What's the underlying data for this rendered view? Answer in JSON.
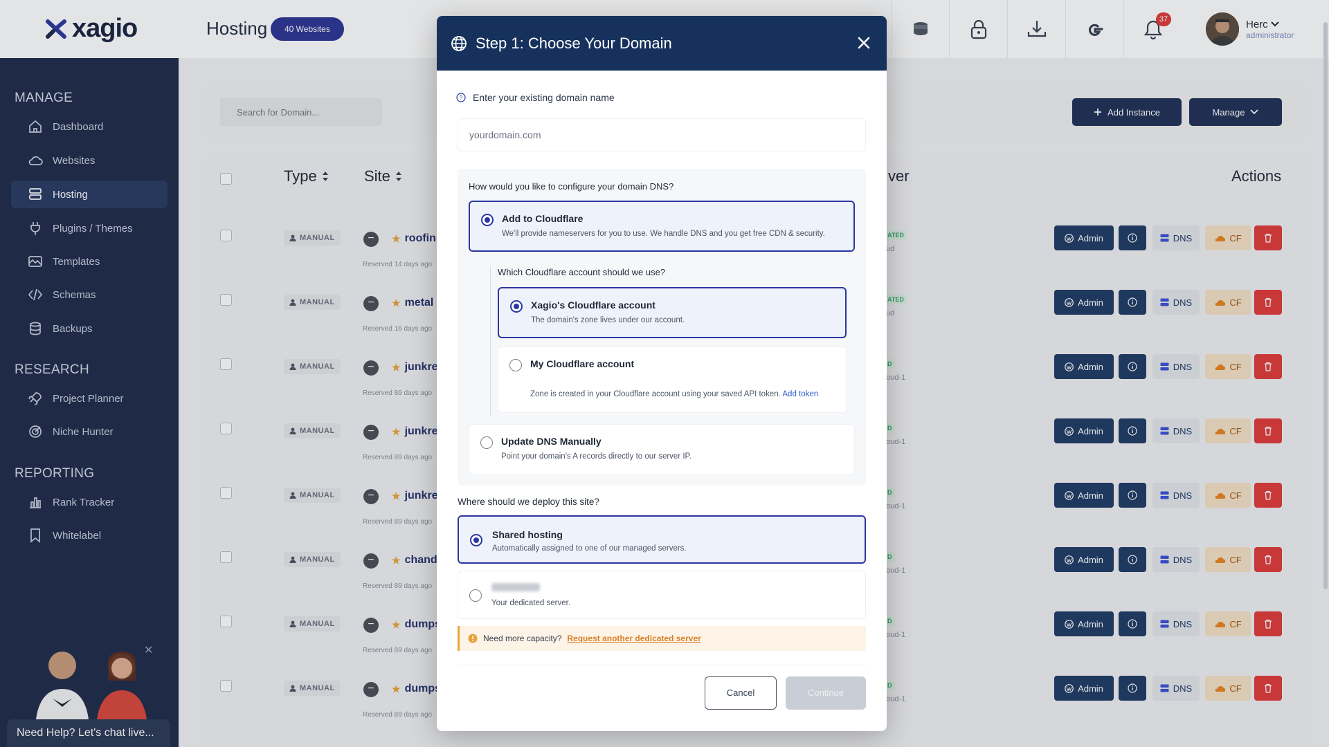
{
  "app": {
    "brand": "xagio",
    "page_title": "Hosting",
    "site_count_badge": "40 Websites",
    "notification_count": "37",
    "user_name": "Herc",
    "user_role": "administrator"
  },
  "sidebar": {
    "manage_label": "MANAGE",
    "research_label": "RESEARCH",
    "reporting_label": "REPORTING",
    "items": [
      {
        "label": "Dashboard",
        "icon": "home-icon"
      },
      {
        "label": "Websites",
        "icon": "cloud-icon"
      },
      {
        "label": "Hosting",
        "icon": "server-icon"
      },
      {
        "label": "Plugins / Themes",
        "icon": "plug-icon"
      },
      {
        "label": "Templates",
        "icon": "template-icon"
      },
      {
        "label": "Schemas",
        "icon": "code-icon"
      },
      {
        "label": "Backups",
        "icon": "database-icon"
      },
      {
        "label": "Project Planner",
        "icon": "rocket-icon"
      },
      {
        "label": "Niche Hunter",
        "icon": "target-icon"
      },
      {
        "label": "Rank Tracker",
        "icon": "bar-chart-icon"
      },
      {
        "label": "Whitelabel",
        "icon": "bookmark-icon"
      }
    ],
    "help_label": "Need Help? Let's chat live..."
  },
  "toolbar": {
    "search_placeholder": "Search for Domain...",
    "add_instance_label": "Add Instance",
    "manage_label": "Manage"
  },
  "table": {
    "headers": {
      "type": "Type",
      "site": "Site",
      "server": "ver",
      "actions": "Actions"
    },
    "type_label": "MANUAL",
    "action_labels": {
      "admin": "Admin",
      "dns": "DNS",
      "cf": "CF"
    },
    "rows": [
      {
        "site": "roofin",
        "reserved": "Reserved 14 days ago",
        "tag": "ATED",
        "server": "ud"
      },
      {
        "site": "metal",
        "reserved": "Reserved 16 days ago",
        "tag": "ATED",
        "server": "ud"
      },
      {
        "site": "junkre",
        "reserved": "Reserved 89 days ago",
        "tag": "D",
        "server": "oud-1"
      },
      {
        "site": "junkre",
        "reserved": "Reserved 89 days ago",
        "tag": "D",
        "server": "oud-1"
      },
      {
        "site": "junkre",
        "reserved": "Reserved 89 days ago",
        "tag": "D",
        "server": "oud-1"
      },
      {
        "site": "chand",
        "reserved": "Reserved 89 days ago",
        "tag": "D",
        "server": "oud-1"
      },
      {
        "site": "dumps",
        "reserved": "Reserved 89 days ago",
        "tag": "D",
        "server": "oud-1"
      },
      {
        "site": "dumps",
        "reserved": "Reserved 89 days ago",
        "tag": "D",
        "server": "oud-1"
      }
    ]
  },
  "modal": {
    "title": "Step 1: Choose Your Domain",
    "domain_label": "Enter your existing domain name",
    "domain_placeholder": "yourdomain.com",
    "dns_question": "How would you like to configure your domain DNS?",
    "dns_options": [
      {
        "title": "Add to Cloudflare",
        "desc": "We'll provide nameservers for you to use. We handle DNS and you get free CDN & security.",
        "selected": true
      },
      {
        "title": "Update DNS Manually",
        "desc": "Point your domain's A records directly to our server IP.",
        "selected": false
      }
    ],
    "cf_question": "Which Cloudflare account should we use?",
    "cf_options": [
      {
        "title": "Xagio's Cloudflare account",
        "desc": "The domain's zone lives under our account.",
        "selected": true
      },
      {
        "title": "My Cloudflare account",
        "desc": "Zone is created in your Cloudflare account using your saved API token.",
        "link": "Add token",
        "selected": false
      }
    ],
    "deploy_question": "Where should we deploy this site?",
    "deploy_options": [
      {
        "title": "Shared hosting",
        "desc": "Automatically assigned to one of our managed servers.",
        "selected": true
      },
      {
        "title": "",
        "desc": "Your dedicated server.",
        "selected": false
      }
    ],
    "capacity_text": "Need more capacity?",
    "capacity_link": "Request another dedicated server",
    "cancel_label": "Cancel",
    "continue_label": "Continue"
  },
  "colors": {
    "sidebar_bg": "#1e2a4a",
    "modal_header": "#16325c",
    "primary": "#2b37a0",
    "danger": "#e03a3a",
    "warning": "#e8a33a"
  }
}
